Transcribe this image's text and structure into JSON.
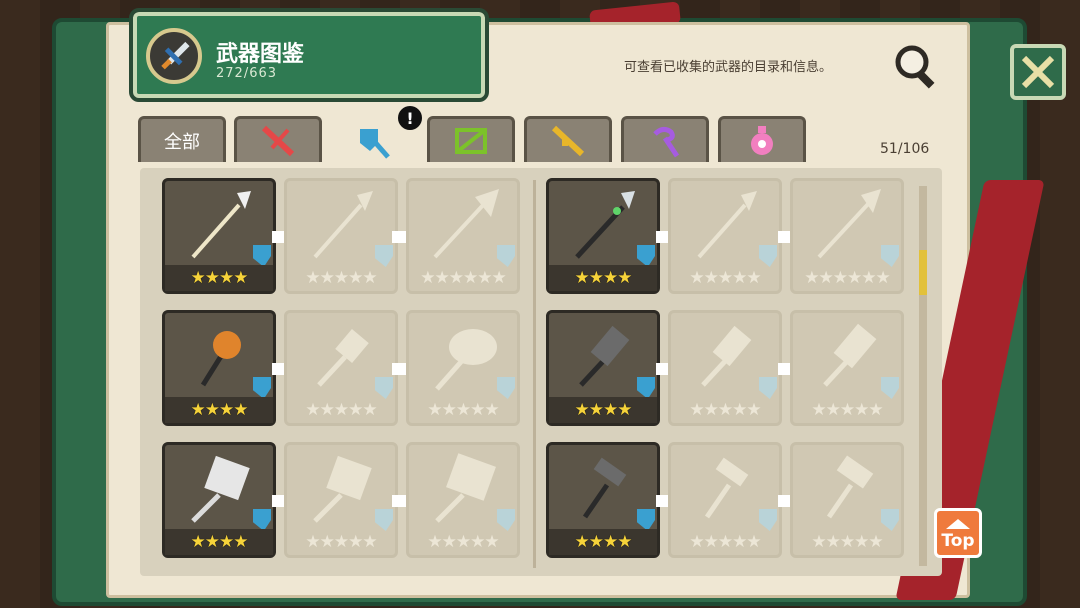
{
  "header": {
    "title": "武器图鉴",
    "count": "272/663",
    "description": "可查看已收集的武器的目录和信息。"
  },
  "tabs": [
    {
      "label": "全部",
      "icon": "",
      "active": false
    },
    {
      "label": "",
      "icon": "sword-icon",
      "active": false
    },
    {
      "label": "",
      "icon": "axe-icon",
      "active": true
    },
    {
      "label": "",
      "icon": "bow-icon",
      "active": false
    },
    {
      "label": "",
      "icon": "gun-icon",
      "active": false
    },
    {
      "label": "",
      "icon": "staff-icon",
      "active": false
    },
    {
      "label": "",
      "icon": "potion-icon",
      "active": false
    }
  ],
  "tab_alert": "!",
  "progress": "51/106",
  "rows": [
    {
      "groups": [
        {
          "stars": [
            "★★★★",
            "★★★★★",
            "★★★★★★"
          ]
        },
        {
          "stars": [
            "★★★★",
            "★★★★★",
            "★★★★★★"
          ]
        }
      ]
    },
    {
      "groups": [
        {
          "stars": [
            "★★★★",
            "★★★★★",
            "★★★★★"
          ]
        },
        {
          "stars": [
            "★★★★",
            "★★★★★",
            "★★★★★"
          ]
        }
      ]
    },
    {
      "groups": [
        {
          "stars": [
            "★★★★",
            "★★★★★",
            "★★★★★"
          ]
        },
        {
          "stars": [
            "★★★★",
            "★★★★★",
            "★★★★★"
          ]
        }
      ]
    }
  ],
  "top_button": "Top",
  "colors": {
    "accent_green": "#2f7a52",
    "star": "#f6d33a",
    "top": "#ef7a3c"
  }
}
